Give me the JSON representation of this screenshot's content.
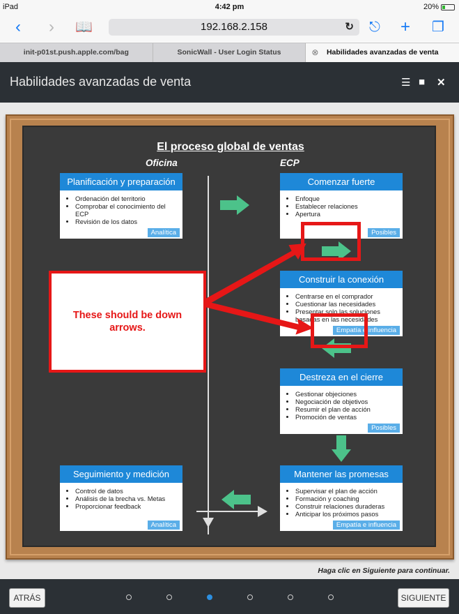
{
  "status_bar": {
    "device": "iPad",
    "time": "4:42 pm",
    "battery": "20%"
  },
  "browser": {
    "url": "192.168.2.158",
    "tabs": [
      {
        "label": "init-p01st.push.apple.com/bag"
      },
      {
        "label": "SonicWall - User Login Status"
      },
      {
        "label": "Habilidades avanzadas de venta"
      }
    ]
  },
  "course": {
    "title": "Habilidades avanzadas de venta"
  },
  "board": {
    "title": "El proceso global de ventas",
    "col_left": "Oficina",
    "col_right": "ECP",
    "cards": {
      "planificacion": {
        "title": "Planificación y preparación",
        "items": [
          "Ordenación del territorio",
          "Comprobar el conocimiento del ECP",
          "Revisión de los datos"
        ],
        "tag": "Analítica"
      },
      "comenzar": {
        "title": "Comenzar fuerte",
        "items": [
          "Enfoque",
          "Establecer relaciones",
          "Apertura"
        ],
        "tag": "Posibles"
      },
      "construir": {
        "title": "Construir la conexión",
        "items": [
          "Centrarse en el comprador",
          "Cuestionar las necesidades",
          "Presentar solo las soluciones basadas en las necesidades"
        ],
        "tag": "Empatía e influencia"
      },
      "destreza": {
        "title": "Destreza en el cierre",
        "items": [
          "Gestionar objeciones",
          "Negociación de objetivos",
          "Resumir el plan de acción",
          "Promoción de ventas"
        ],
        "tag": "Posibles"
      },
      "seguimiento": {
        "title": "Seguimiento y medición",
        "items": [
          "Control de datos",
          "Análisis de la brecha vs. Metas",
          "Proporcionar feedback"
        ],
        "tag": "Analítica"
      },
      "mantener": {
        "title": "Mantener las promesas",
        "items": [
          "Supervisar el plan de acción",
          "Formación y coaching",
          "Construir relaciones duraderas",
          "Anticipar los próximos pasos"
        ],
        "tag": "Empatía e influencia"
      }
    }
  },
  "annotation": {
    "text": "These should be down arrows."
  },
  "hint": "Haga clic en Siguiente para continuar.",
  "nav": {
    "back": "ATRÁS",
    "next": "SIGUIENTE",
    "pages": 6,
    "current_page": 3
  }
}
